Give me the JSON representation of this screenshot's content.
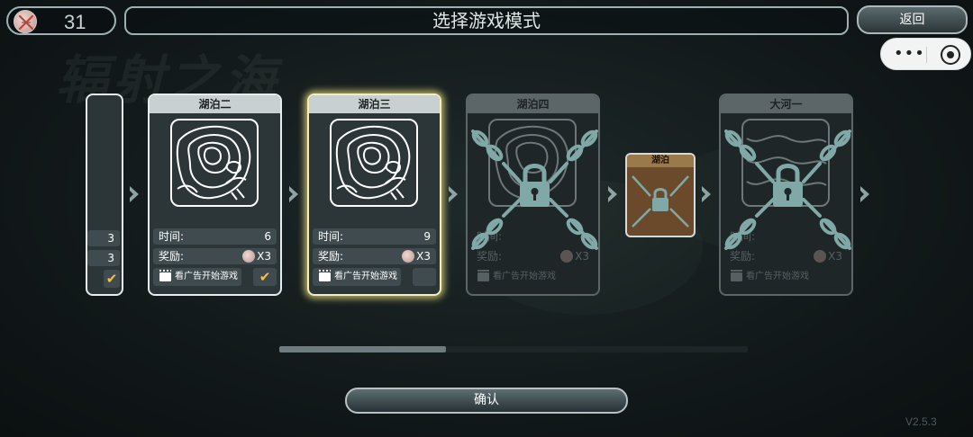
{
  "header": {
    "coin_count": "31",
    "title": "选择游戏模式",
    "back_label": "返回",
    "capsule_menu_icon": "more-dots-icon",
    "capsule_close_icon": "target-circle-icon"
  },
  "background": {
    "game_logo_text": "辐射之海"
  },
  "cards": [
    {
      "name": "",
      "time_label": "",
      "time_value": "3",
      "reward_label": "",
      "reward_value": "3",
      "state": "partial"
    },
    {
      "name": "湖泊二",
      "time_label": "时间:",
      "time_value": "6",
      "reward_label": "奖励:",
      "reward_value": "X3",
      "ad_label": "看广告开始游戏",
      "check": "✔",
      "state": "completed"
    },
    {
      "name": "湖泊三",
      "time_label": "时间:",
      "time_value": "9",
      "reward_label": "奖励:",
      "reward_value": "X3",
      "ad_label": "看广告开始游戏",
      "check": "",
      "state": "selected"
    },
    {
      "name": "湖泊四",
      "time_label": "时间:",
      "time_value": "",
      "reward_label": "奖励:",
      "reward_value": "X3",
      "ad_label": "看广告开始游戏",
      "state": "locked"
    },
    {
      "name": "湖泊",
      "state": "locked-mini"
    },
    {
      "name": "大河一",
      "time_label": "时间:",
      "time_value": "",
      "reward_label": "奖励:",
      "reward_value": "X3",
      "ad_label": "看广告开始游戏",
      "state": "locked"
    }
  ],
  "scroll": {
    "position_fraction": 0.35
  },
  "footer": {
    "confirm_label": "确认",
    "version": "V2.5.3"
  },
  "colors": {
    "selected_glow": "#f4efb8",
    "check_color": "#f2c14e",
    "lock_color": "#7fa8a6"
  }
}
